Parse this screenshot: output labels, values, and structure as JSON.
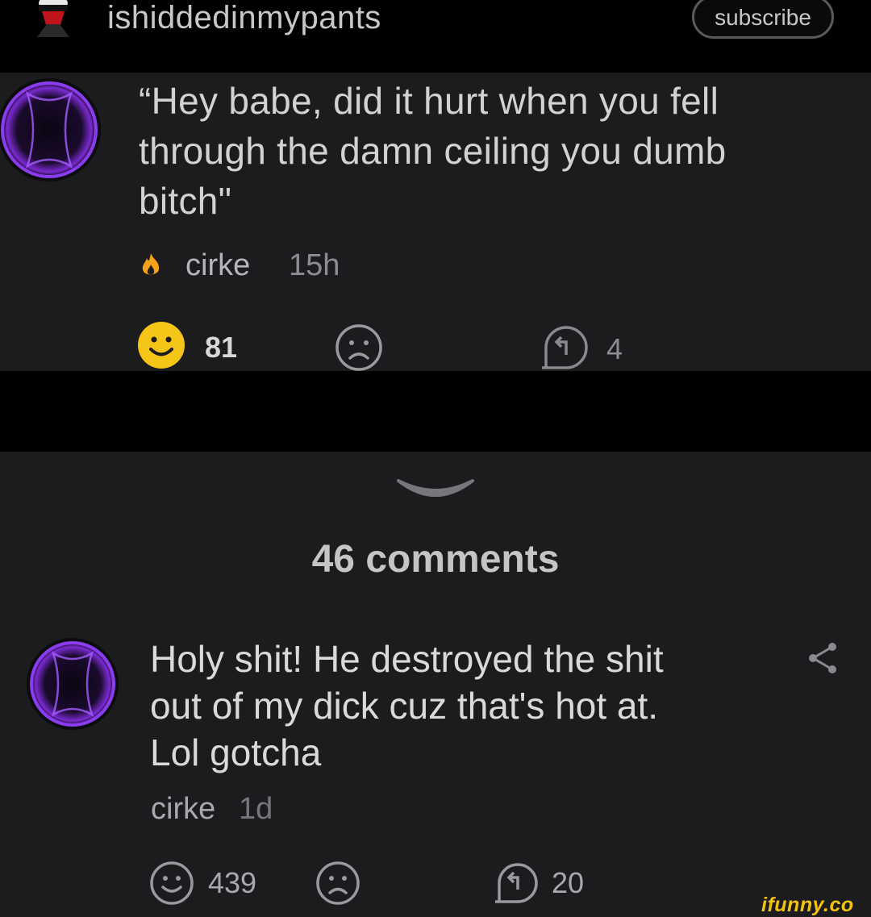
{
  "header": {
    "username": "ishiddedinmypants",
    "subscribe_label": "subscribe"
  },
  "first_comment": {
    "text": "“Hey babe, did it hurt when you fell\nthrough the damn ceiling you dumb\nbitch\"",
    "username": "cirke",
    "time": "15h",
    "smile_count": "81",
    "reply_count": "4"
  },
  "comments_section": {
    "count_label": "46 comments"
  },
  "second_comment": {
    "text": "Holy shit! He destroyed the shit\nout of my dick cuz that's hot at.\nLol gotcha",
    "username": "cirke",
    "time": "1d",
    "smile_count": "439",
    "reply_count": "20"
  },
  "watermark": "ifunny.co",
  "colors": {
    "background": "#1c1c1e",
    "header_bg": "#000000",
    "smile_active": "#f5c518",
    "avatar_glow": "#9b3dff",
    "watermark": "#f4c20d"
  },
  "icons": [
    "user-avatar-icon",
    "fire-icon",
    "smile-icon",
    "frown-icon",
    "reply-icon",
    "chevron-down-icon",
    "share-icon"
  ]
}
